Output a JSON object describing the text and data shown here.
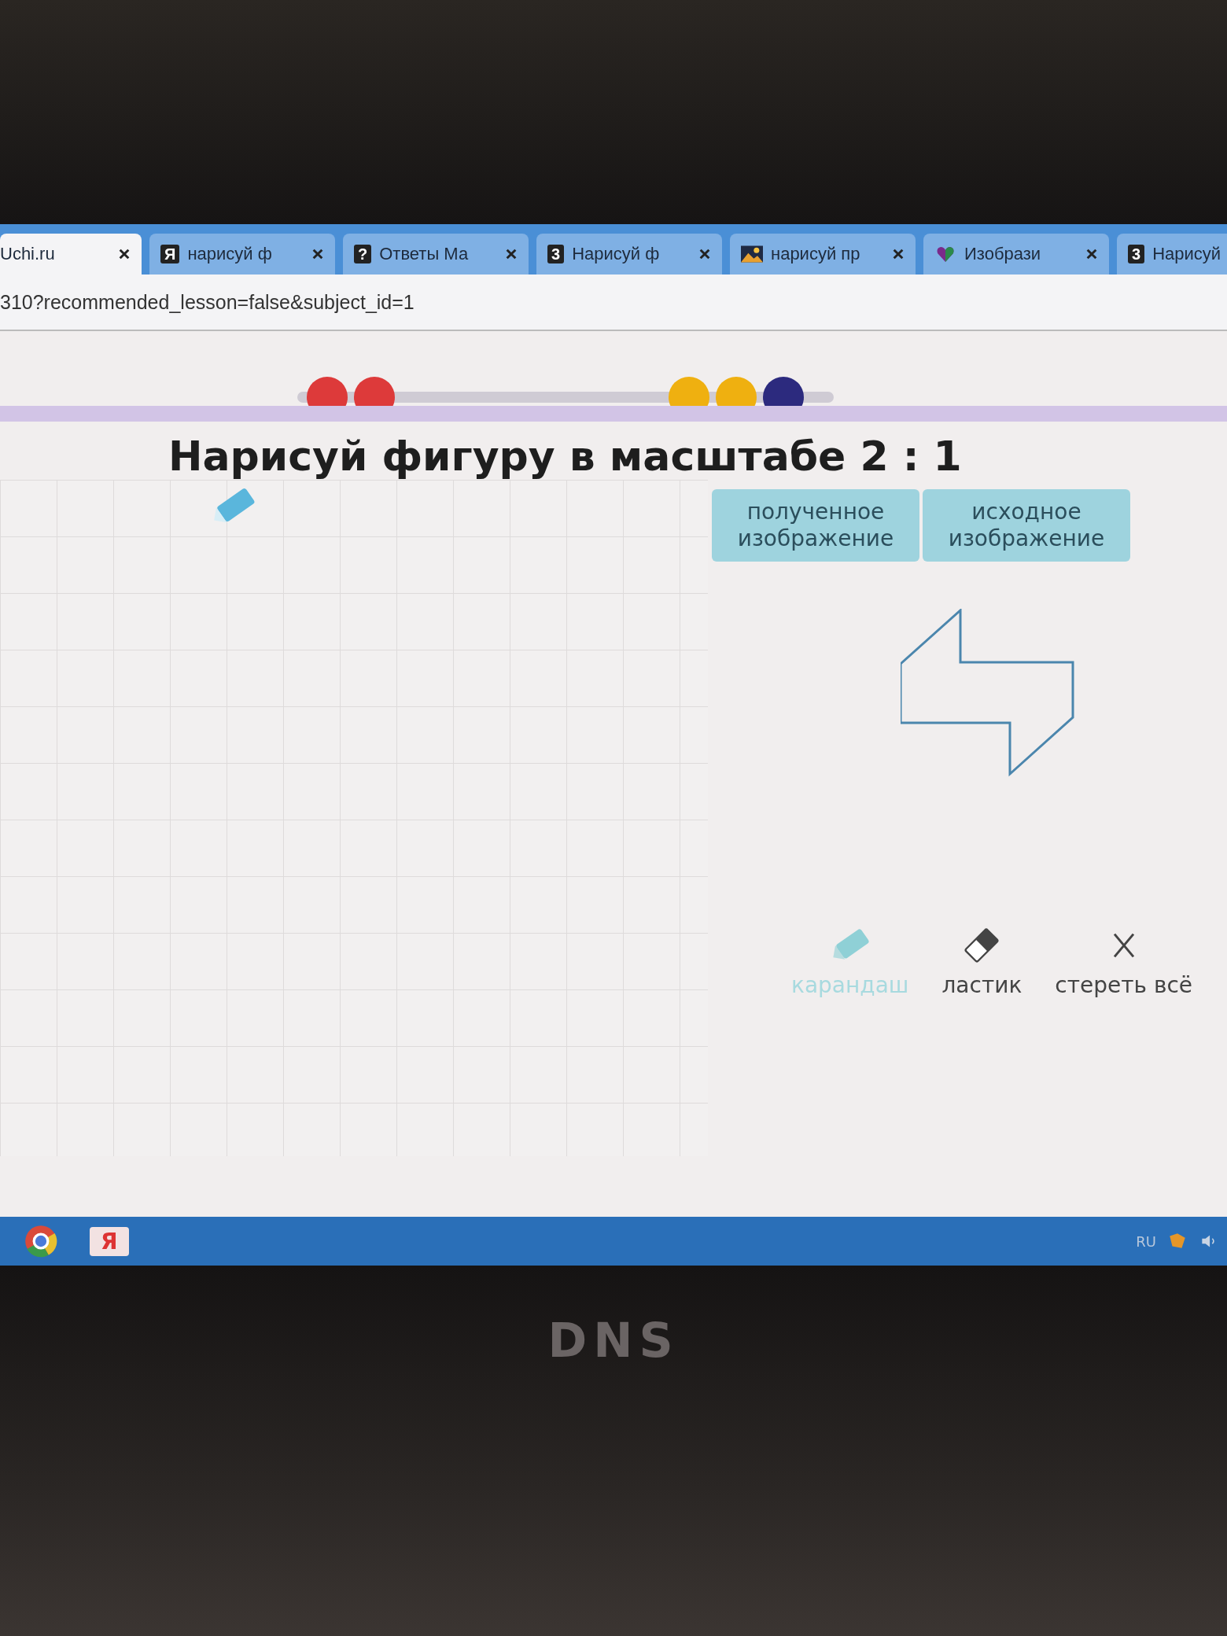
{
  "browser": {
    "tabs": [
      {
        "label": "Uchi.ru",
        "selected": true,
        "kind": "none"
      },
      {
        "label": "нарисуй ф",
        "selected": false,
        "kind": "letter",
        "icon_text": "Я"
      },
      {
        "label": "Ответы Ма",
        "selected": false,
        "kind": "letter",
        "icon_text": "?"
      },
      {
        "label": "Нарисуй ф",
        "selected": false,
        "kind": "letter",
        "icon_text": "3"
      },
      {
        "label": "нарисуй пр",
        "selected": false,
        "kind": "picture"
      },
      {
        "label": "Изобрази",
        "selected": false,
        "kind": "heart"
      },
      {
        "label": "Нарисуй",
        "selected": false,
        "kind": "letter",
        "icon_text": "3"
      }
    ],
    "address": "310?recommended_lesson=false&subject_id=1"
  },
  "progress": {
    "dots": [
      {
        "color": "#dd3a3a"
      },
      {
        "color": "#dd3a3a"
      },
      {
        "color": "#efb010"
      },
      {
        "color": "#efb010"
      },
      {
        "color": "#2c2a7e"
      }
    ]
  },
  "task": {
    "title": "Нарисуй фигуру в масштабе 2 : 1",
    "labels": [
      "полученное изображение",
      "исходное изображение"
    ],
    "tools": [
      {
        "label": "карандаш",
        "kind": "pencil",
        "selected": true
      },
      {
        "label": "ластик",
        "kind": "eraser",
        "selected": false
      },
      {
        "label": "стереть всё",
        "kind": "clear",
        "selected": false
      }
    ]
  },
  "taskbar": {
    "apps": [
      {
        "kind": "chrome"
      },
      {
        "kind": "yandex",
        "icon_text": "Я"
      }
    ],
    "language": "RU"
  },
  "laptop": {
    "logo": "DNS"
  }
}
